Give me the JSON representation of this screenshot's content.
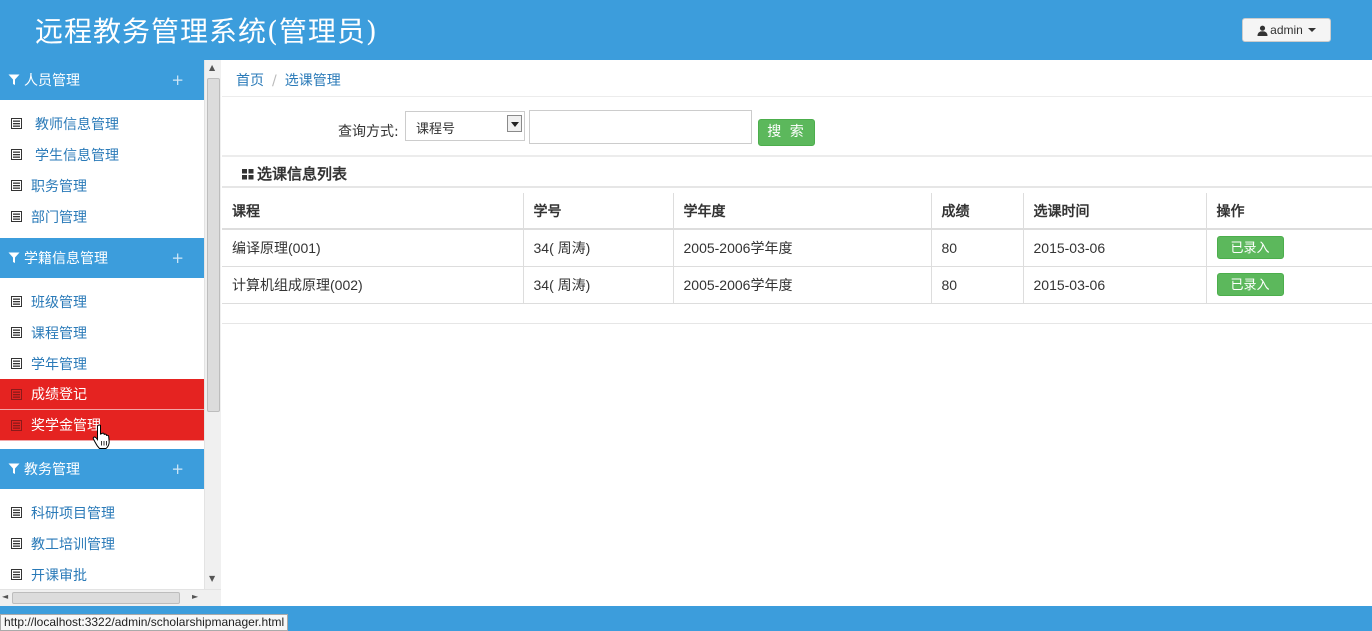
{
  "header": {
    "title": "远程教务管理系统(管理员)",
    "user_label": "admin"
  },
  "sidebar": {
    "groups": [
      {
        "label": "人员管理",
        "items": [
          {
            "label": "教师信息管理"
          },
          {
            "label": "学生信息管理"
          },
          {
            "label": "职务管理"
          },
          {
            "label": "部门管理"
          }
        ]
      },
      {
        "label": "学籍信息管理",
        "items": [
          {
            "label": "班级管理"
          },
          {
            "label": "课程管理"
          },
          {
            "label": "学年管理"
          },
          {
            "label": "成绩登记"
          },
          {
            "label": "奖学金管理"
          }
        ]
      },
      {
        "label": "教务管理",
        "items": [
          {
            "label": "科研项目管理"
          },
          {
            "label": "教工培训管理"
          },
          {
            "label": "开课审批"
          }
        ]
      }
    ],
    "plus": "+",
    "highlight_color": "#e52321"
  },
  "breadcrumb": {
    "home": "首页",
    "separator": "/",
    "current": "选课管理"
  },
  "search": {
    "label": "查询方式:",
    "selected": "课程号",
    "value": "",
    "button": "搜 索"
  },
  "panel": {
    "title": "选课信息列表"
  },
  "table": {
    "headers": [
      "课程",
      "学号",
      "学年度",
      "成绩",
      "选课时间",
      "操作"
    ],
    "rows": [
      {
        "course": "编译原理(001)",
        "student": "34( 周涛)",
        "year": "2005-2006学年度",
        "score": "80",
        "date": "2015-03-06",
        "action": "已录入"
      },
      {
        "course": "计算机组成原理(002)",
        "student": "34( 周涛)",
        "year": "2005-2006学年度",
        "score": "80",
        "date": "2015-03-06",
        "action": "已录入"
      }
    ]
  },
  "status_bar": {
    "url": "http://localhost:3322/admin/scholarshipmanager.html"
  },
  "colors": {
    "primary": "#3c9ddc",
    "success": "#5cb85c",
    "active": "#e52321"
  }
}
